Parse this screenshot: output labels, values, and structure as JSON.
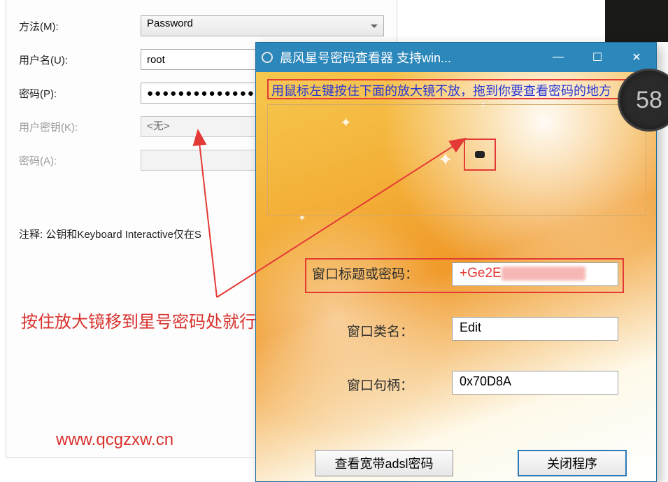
{
  "left_form": {
    "method_label": "方法(M):",
    "method_value": "Password",
    "user_label": "用户名(U):",
    "user_value": "root",
    "pwd_label": "密码(P):",
    "pwd_value": "●●●●●●●●●●●●●●●",
    "userkey_label": "用户密钥(K):",
    "userkey_value": "<无>",
    "pwd2_label": "密码(A):",
    "pwd2_value": "",
    "note": "注释: 公钥和Keyboard Interactive仅在S"
  },
  "annotations": {
    "hint": "按住放大镜移到星号密码处就行了",
    "url": "www.qcgzxw.cn"
  },
  "tool": {
    "title": "晨风星号密码查看器 支持win...",
    "instruction": "用鼠标左键按住下面的放大镜不放，拖到你要查看密码的地方",
    "row1_label": "窗口标题或密码：",
    "row1_value": "+Ge2E",
    "row2_label": "窗口类名：",
    "row2_value": "Edit",
    "row3_label": "窗口句柄：",
    "row3_value": "0x70D8A",
    "btn_adsl": "查看宽带adsl密码",
    "btn_close": "关闭程序"
  },
  "side_widget": {
    "text": "58"
  }
}
